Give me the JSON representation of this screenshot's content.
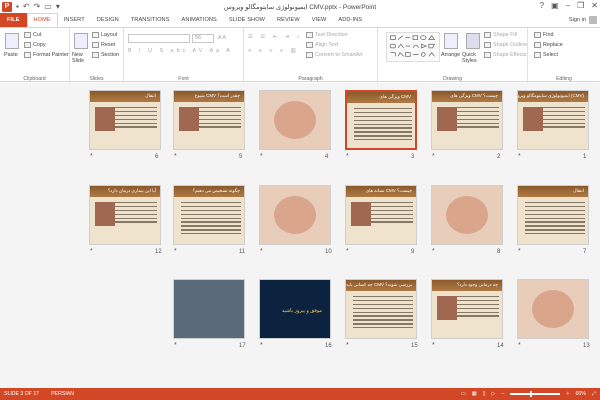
{
  "window": {
    "title": "ایمیونولوژی سایتومگالو ویروس CMV.pptx - PowerPoint",
    "signin": "Sign in"
  },
  "tabs": [
    "FILE",
    "HOME",
    "INSERT",
    "DESIGN",
    "TRANSITIONS",
    "ANIMATIONS",
    "SLIDE SHOW",
    "REVIEW",
    "VIEW",
    "ADD-INS"
  ],
  "ribbon": {
    "clipboard": {
      "label": "Clipboard",
      "paste": "Paste",
      "cut": "Cut",
      "copy": "Copy",
      "format_painter": "Format Painter"
    },
    "slides": {
      "label": "Slides",
      "new_slide": "New Slide",
      "layout": "Layout",
      "reset": "Reset",
      "section": "Section"
    },
    "font": {
      "label": "Font",
      "size": "56"
    },
    "paragraph": {
      "label": "Paragraph",
      "text_direction": "Text Direction",
      "align_text": "Align Text",
      "convert_smartart": "Convert to SmartArt"
    },
    "drawing": {
      "label": "Drawing",
      "arrange": "Arrange",
      "quick_styles": "Quick Styles",
      "shape_fill": "Shape Fill",
      "shape_outline": "Shape Outline",
      "shape_effects": "Shape Effects"
    },
    "editing": {
      "label": "Editing",
      "find": "Find",
      "replace": "Replace",
      "select": "Select"
    }
  },
  "slides": [
    {
      "number": "1",
      "title": "ایمیونولوژی سایتومگالو ویروس (CMV)",
      "kind": "text-pic"
    },
    {
      "number": "2",
      "title": "ویژگی های CMV چیست؟",
      "kind": "text-pic"
    },
    {
      "number": "3",
      "title": "ویژگی های CMV",
      "kind": "text",
      "selected": true
    },
    {
      "number": "4",
      "title": "",
      "kind": "photo"
    },
    {
      "number": "5",
      "title": "شیوع CMV چقدر است؟",
      "kind": "text-pic"
    },
    {
      "number": "6",
      "title": "انتقال",
      "kind": "text-pic"
    },
    {
      "number": "7",
      "title": "انتقال",
      "kind": "text"
    },
    {
      "number": "8",
      "title": "",
      "kind": "photo"
    },
    {
      "number": "9",
      "title": "نشانه های CMV چیست؟",
      "kind": "text-pic"
    },
    {
      "number": "10",
      "title": "",
      "kind": "photo"
    },
    {
      "number": "11",
      "title": "چگونه تشخیص می دهیم؟",
      "kind": "text"
    },
    {
      "number": "12",
      "title": "آیا این بیماری درمان دارد؟",
      "kind": "text-pic"
    },
    {
      "number": "13",
      "title": "",
      "kind": "photo"
    },
    {
      "number": "14",
      "title": "چه درمانی وجود دارد؟",
      "kind": "text-pic"
    },
    {
      "number": "15",
      "title": "چه کسانی باید در برابر CMV بررسی شوند؟",
      "kind": "text"
    },
    {
      "number": "16",
      "title": "موفق و پیروز باشید",
      "kind": "dark"
    },
    {
      "number": "17",
      "title": "",
      "kind": "laptop"
    }
  ],
  "status": {
    "slide_info": "SLIDE 3 OF 17",
    "language": "PERSIAN",
    "zoom": "66%"
  },
  "colors": {
    "accent": "#d24726",
    "slide_bg": "#efe3cd",
    "title_bar": "#8b5a2b"
  }
}
